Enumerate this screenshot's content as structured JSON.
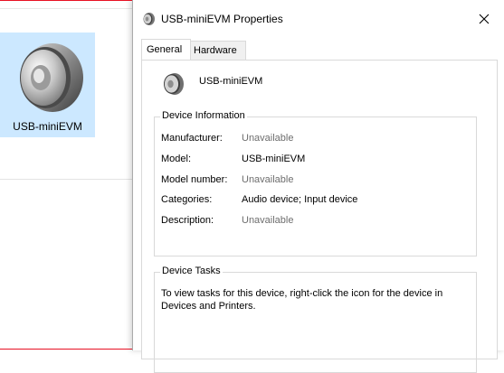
{
  "desktop": {
    "item_label": "USB-miniEVM"
  },
  "dialog": {
    "title": "USB-miniEVM Properties",
    "tabs": [
      {
        "label": "General"
      },
      {
        "label": "Hardware"
      }
    ],
    "device_name": "USB-miniEVM",
    "device_info": {
      "legend": "Device Information",
      "rows": [
        {
          "key": "Manufacturer:",
          "value": "Unavailable",
          "muted": true
        },
        {
          "key": "Model:",
          "value": "USB-miniEVM",
          "muted": false
        },
        {
          "key": "Model number:",
          "value": "Unavailable",
          "muted": true
        },
        {
          "key": "Categories:",
          "value": "Audio device; Input device",
          "muted": false
        },
        {
          "key": "Description:",
          "value": "Unavailable",
          "muted": true
        }
      ]
    },
    "device_tasks": {
      "legend": "Device Tasks",
      "text": "To view tasks for this device, right-click the icon for the device in Devices and Printers."
    }
  },
  "icons": {
    "speaker": "speaker-icon",
    "close": "close-icon"
  }
}
